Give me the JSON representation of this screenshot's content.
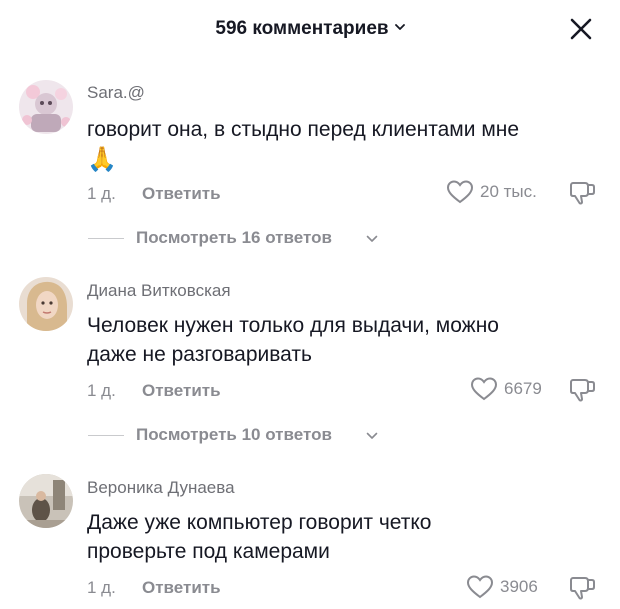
{
  "header": {
    "title": "596 комментариев",
    "chevron_icon": "chevron-down-icon",
    "close_icon": "close-icon"
  },
  "comments": [
    {
      "username": "Sara.@",
      "text": "говорит она, в стыдно перед клиентами мне",
      "emoji": "🙏",
      "time": "1 д.",
      "reply_label": "Ответить",
      "likes": "20 тыс.",
      "replies_label": "Посмотреть 16 ответов"
    },
    {
      "username": "Диана Витковская",
      "text_line1": "Человек нужен только для выдачи, можно",
      "text_line2": "даже не разговаривать",
      "time": "1 д.",
      "reply_label": "Ответить",
      "likes": "6679",
      "replies_label": "Посмотреть 10 ответов"
    },
    {
      "username": "Вероника Дунаева",
      "text_line1": "Даже уже компьютер говорит четко",
      "text_line2": "проверьте под камерами",
      "time": "1 д.",
      "reply_label": "Ответить",
      "likes": "3906"
    }
  ],
  "colors": {
    "primary_text": "#161823",
    "secondary_text": "#8a8b91",
    "username": "#6e6f75"
  }
}
